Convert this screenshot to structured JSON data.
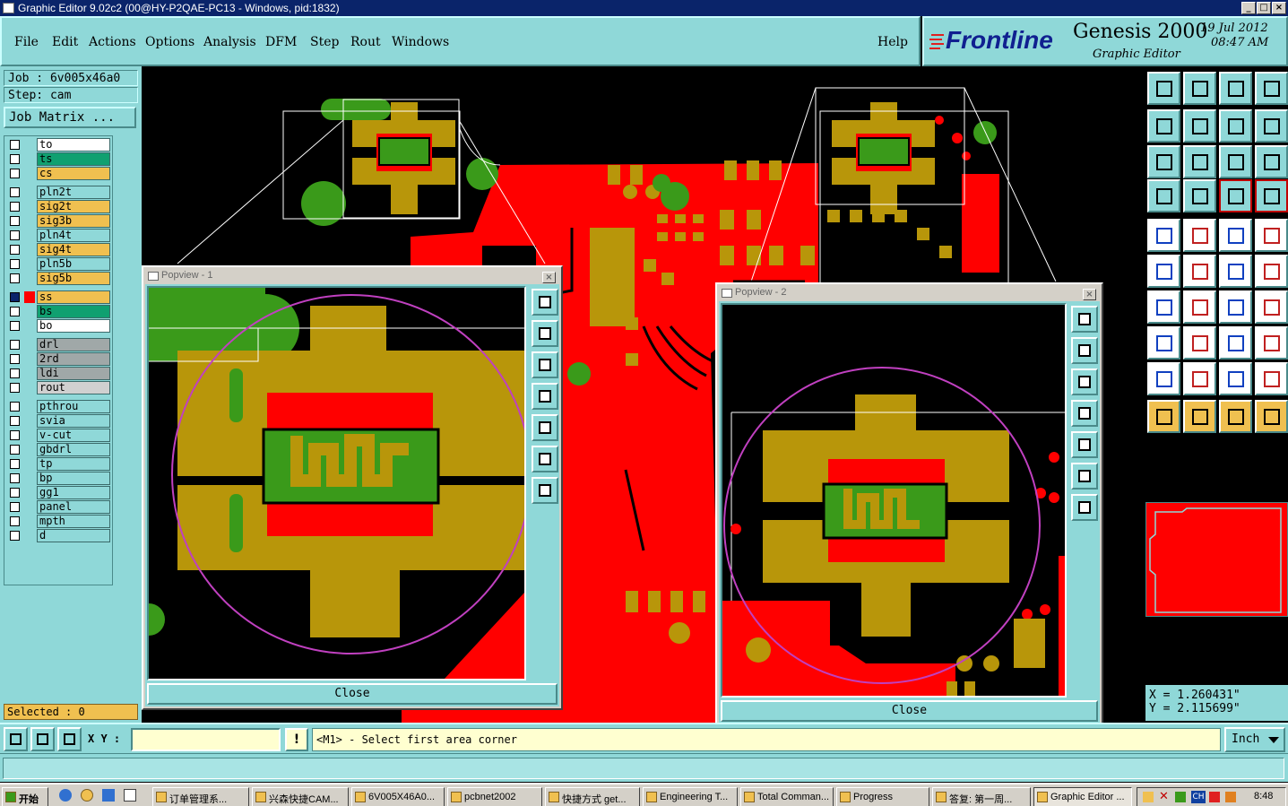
{
  "window": {
    "title": "Graphic Editor 9.02c2 (00@HY-P2QAE-PC13 - Windows, pid:1832)",
    "minimize": "_",
    "maximize": "□",
    "close": "×"
  },
  "menu": {
    "items": [
      "File",
      "Edit",
      "Actions",
      "Options",
      "Analysis",
      "DFM",
      "Step",
      "Rout",
      "Windows"
    ],
    "help": "Help"
  },
  "brand": {
    "logo": "Frontline",
    "product": "Genesis 2000",
    "subtitle": "Graphic Editor",
    "date": "19 Jul 2012",
    "time": "08:47 AM"
  },
  "job": {
    "job_label": "Job : 6v005x46a0",
    "step_label": "Step: cam",
    "job_matrix": "Job Matrix ..."
  },
  "layers": [
    {
      "name": "to",
      "color": "#ffffff"
    },
    {
      "name": "ts",
      "color": "#10a070"
    },
    {
      "name": "cs",
      "color": "#f0c050"
    },
    {
      "name": "pln2t",
      "color": "#8fd8d8"
    },
    {
      "name": "sig2t",
      "color": "#f0c050"
    },
    {
      "name": "sig3b",
      "color": "#f0c050"
    },
    {
      "name": "pln4t",
      "color": "#8fd8d8"
    },
    {
      "name": "sig4t",
      "color": "#f0c050"
    },
    {
      "name": "pln5b",
      "color": "#8fd8d8"
    },
    {
      "name": "sig5b",
      "color": "#f0c050"
    },
    {
      "name": "ss",
      "color": "#f0c050"
    },
    {
      "name": "bs",
      "color": "#10a070"
    },
    {
      "name": "bo",
      "color": "#ffffff"
    },
    {
      "name": "drl",
      "color": "#a0a8a8"
    },
    {
      "name": "2rd",
      "color": "#a0a8a8"
    },
    {
      "name": "ldi",
      "color": "#a0a8a8"
    },
    {
      "name": "rout",
      "color": "#d0d0d0"
    },
    {
      "name": "pthrou",
      "color": "#8fd8d8"
    },
    {
      "name": "svia",
      "color": "#8fd8d8"
    },
    {
      "name": "v-cut",
      "color": "#8fd8d8"
    },
    {
      "name": "gbdrl",
      "color": "#8fd8d8"
    },
    {
      "name": "tp",
      "color": "#8fd8d8"
    },
    {
      "name": "bp",
      "color": "#8fd8d8"
    },
    {
      "name": "gg1",
      "color": "#8fd8d8"
    },
    {
      "name": "panel",
      "color": "#8fd8d8"
    },
    {
      "name": "mpth",
      "color": "#8fd8d8"
    },
    {
      "name": "d",
      "color": "#8fd8d8"
    }
  ],
  "selected": "Selected : 0",
  "popview1": {
    "title": "Popview - 1",
    "close": "Close"
  },
  "popview2": {
    "title": "Popview - 2",
    "close": "Close"
  },
  "coords": {
    "x": "X = 1.260431\"",
    "y": "Y = 2.115699\""
  },
  "command": {
    "xy_label": "X Y :",
    "input_value": "",
    "warn": "!",
    "prompt": "<M1> - Select first area corner",
    "units": "Inch"
  },
  "taskbar": {
    "start": "开始",
    "tasks": [
      "订单管理系...",
      "兴森快捷CAM...",
      "6V005X46A0...",
      "pcbnet2002",
      "快捷方式 get...",
      "Engineering T...",
      "Total Comman...",
      "Progress",
      "答复: 第一周...",
      "Graphic Editor ..."
    ],
    "clock": "8:48",
    "tray_text": "CH"
  },
  "colors": {
    "panel": "#8fd8d8",
    "copper": "#b8960a",
    "red": "#ff0000",
    "green": "#3a9a1a",
    "accent_title": "#0a246a",
    "magenta": "#c040c0"
  }
}
